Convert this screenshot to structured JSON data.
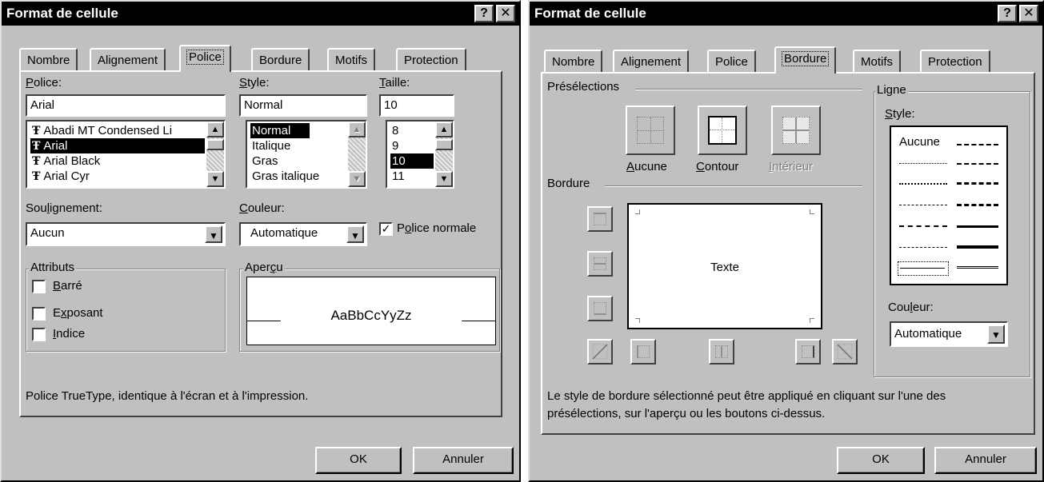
{
  "left_dialog": {
    "title": "Format de cellule",
    "help_button": "?",
    "close_button": "✕",
    "tabs": [
      "Nombre",
      "Alignement",
      "Police",
      "Bordure",
      "Motifs",
      "Protection"
    ],
    "active_tab": "Police",
    "police_label": "Police:",
    "police_value": "Arial",
    "police_list": [
      "Abadi MT Condensed Li",
      "Arial",
      "Arial Black",
      "Arial Cyr"
    ],
    "police_selected": "Arial",
    "style_label": "Style:",
    "style_value": "Normal",
    "style_list": [
      "Normal",
      "Italique",
      "Gras",
      "Gras italique"
    ],
    "style_selected": "Normal",
    "taille_label": "Taille:",
    "taille_value": "10",
    "taille_list": [
      "8",
      "9",
      "10",
      "11"
    ],
    "taille_selected": "10",
    "soulignement_label": "Soulignement:",
    "soulignement_value": "Aucun",
    "couleur_label": "Couleur:",
    "couleur_value": "Automatique",
    "police_normale_label": "Police normale",
    "police_normale_checked": true,
    "attributs_label": "Attributs",
    "attributs": [
      {
        "label": "Barré",
        "checked": false
      },
      {
        "label": "Exposant",
        "checked": false
      },
      {
        "label": "Indice",
        "checked": false
      }
    ],
    "apercu_label": "Aperçu",
    "apercu_text": "AaBbCcYyZz",
    "info_text": "Police TrueType, identique à l'écran et à l'impression.",
    "ok_label": "OK",
    "cancel_label": "Annuler"
  },
  "right_dialog": {
    "title": "Format de cellule",
    "help_button": "?",
    "close_button": "✕",
    "tabs": [
      "Nombre",
      "Alignement",
      "Police",
      "Bordure",
      "Motifs",
      "Protection"
    ],
    "active_tab": "Bordure",
    "preselections_label": "Présélections",
    "preset_aucune": "Aucune",
    "preset_contour": "Contour",
    "preset_interieur": "Intérieur",
    "bordure_label": "Bordure",
    "preview_text": "Texte",
    "ligne_label": "Ligne",
    "style_label": "Style:",
    "style_none": "Aucune",
    "couleur_label": "Couleur:",
    "couleur_value": "Automatique",
    "info_text_1": "Le style de bordure sélectionné peut être appliqué en cliquant sur l'une des",
    "info_text_2": "présélections, sur l'aperçu ou les boutons ci-dessus.",
    "ok_label": "OK",
    "cancel_label": "Annuler"
  }
}
